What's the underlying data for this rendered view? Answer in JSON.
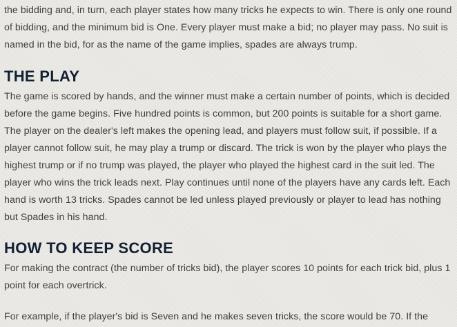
{
  "paragraph_bidding": "the bidding and, in turn, each player states how many tricks he expects to win. There is only one round of bidding, and the minimum bid is One. Every player must make a bid; no player may pass. No suit is named in the bid, for as the name of the game implies, spades are always trump.",
  "heading_play": "THE PLAY",
  "paragraph_play": "The game is scored by hands, and the winner must make a certain number of points, which is decided before the game begins. Five hundred points is common, but 200 points is suitable for a short game. The player on the dealer's left makes the opening lead, and players must follow suit, if possible. If a player cannot follow suit, he may play a trump or discard. The trick is won by the player who plays the highest trump or if no trump was played, the player who played the highest card in the suit led. The player who wins the trick leads next. Play continues until none of the players have any cards left. Each hand is worth 13 tricks. Spades cannot be led unless played previously or player to lead has nothing but Spades in his hand.",
  "heading_score": "HOW TO KEEP SCORE",
  "paragraph_score": "For making the contract (the number of tricks bid), the player scores 10 points for each trick bid, plus 1 point for each overtrick.",
  "paragraph_example": "For example, if the player's bid is Seven and he makes seven tricks, the score would be 70. If the"
}
